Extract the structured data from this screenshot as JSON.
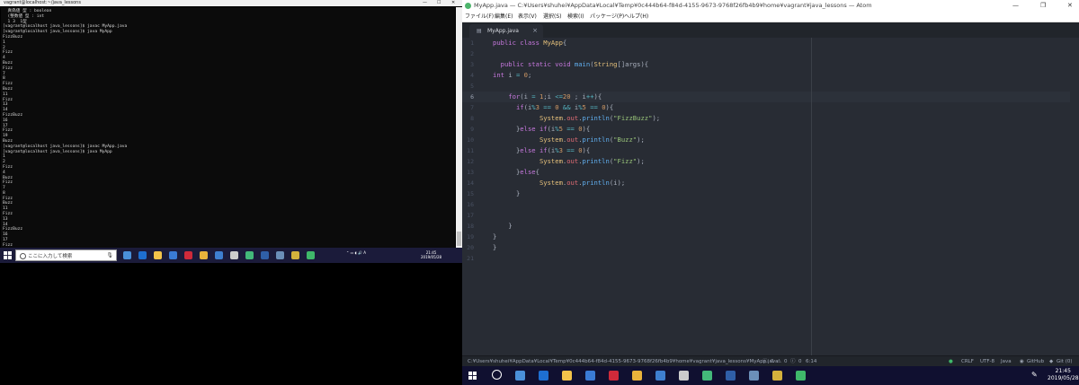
{
  "terminal": {
    "title": "vagrant@localhost:~/java_lessons",
    "controls": [
      "—",
      "☐",
      "✕"
    ],
    "lines": [
      "  真偽値 型 : boolean",
      "  (整数値 型 : int",
      "  1 3  1型",
      "[vagrant@localhost java_lessons]$ javac MyApp.java",
      "[vagrant@localhost java_lessons]$ java MyApp",
      "FizzBuzz",
      "1",
      "2",
      "Fizz",
      "4",
      "Buzz",
      "Fizz",
      "7",
      "8",
      "Fizz",
      "Buzz",
      "11",
      "Fizz",
      "13",
      "14",
      "FizzBuzz",
      "16",
      "17",
      "Fizz",
      "19",
      "Buzz",
      "[vagrant@localhost java_lessons]$ javac MyApp.java",
      "[vagrant@localhost java_lessons]$ java MyApp",
      "1",
      "2",
      "Fizz",
      "4",
      "Buzz",
      "Fizz",
      "7",
      "8",
      "Fizz",
      "Buzz",
      "11",
      "Fizz",
      "13",
      "14",
      "FizzBuzz",
      "16",
      "17",
      "Fizz",
      "19",
      "Buzz"
    ],
    "prompt": "[vagrant@localhost java_lessons]$ "
  },
  "taskbar_left": {
    "search_placeholder": "ここに入力して検索",
    "clock_time": "21:45",
    "clock_date": "2019/05/28",
    "icons": [
      {
        "name": "task-view-icon",
        "color": "#4a90d9"
      },
      {
        "name": "edge-icon",
        "color": "#1e6fd0"
      },
      {
        "name": "explorer-icon",
        "color": "#f3c34a"
      },
      {
        "name": "store-icon",
        "color": "#3a7bd5"
      },
      {
        "name": "opera-icon",
        "color": "#d02a3a"
      },
      {
        "name": "chrome-icon",
        "color": "#e9b33b"
      },
      {
        "name": "mail-icon",
        "color": "#3e7fcf"
      },
      {
        "name": "media-icon",
        "color": "#cccccc"
      },
      {
        "name": "atom-app-icon",
        "color": "#43b97a"
      },
      {
        "name": "powershell-icon",
        "color": "#2f5fa7"
      },
      {
        "name": "terminal-app-icon",
        "color": "#6b8fb8"
      },
      {
        "name": "app-yellow-icon",
        "color": "#d4b13c"
      },
      {
        "name": "app-green-icon",
        "color": "#3fb86a"
      }
    ]
  },
  "atom": {
    "title": "MyApp.java — C:¥Users¥shuhei¥AppData¥Local¥Temp¥0c444b64-f84d-4155-9673-9768f26fb4b9¥home¥vagrant¥java_lessons — Atom",
    "window_controls": [
      "—",
      "❐",
      "✕"
    ],
    "menu": [
      "ファイル(F)",
      "編集(E)",
      "表示(V)",
      "選択(S)",
      "検索(I)",
      "パッケージ(P)",
      "ヘルプ(H)"
    ],
    "tab_label": "MyApp.java",
    "active_line": 6,
    "lines": [
      [
        [
          "kw",
          "public "
        ],
        [
          "kw",
          "class "
        ],
        [
          "cls",
          "MyApp"
        ],
        [
          "p",
          "{"
        ]
      ],
      [],
      [
        [
          "p",
          "  "
        ],
        [
          "kw",
          "public "
        ],
        [
          "kw",
          "static "
        ],
        [
          "kw",
          "void "
        ],
        [
          "fn",
          "main"
        ],
        [
          "p",
          "("
        ],
        [
          "cls",
          "String"
        ],
        [
          "p",
          "[]args){"
        ]
      ],
      [
        [
          "kw",
          "int "
        ],
        [
          "p",
          "i "
        ],
        [
          "op",
          "= "
        ],
        [
          "num",
          "0"
        ],
        [
          "p",
          ";"
        ]
      ],
      [],
      [
        [
          "p",
          "    "
        ],
        [
          "kw",
          "for"
        ],
        [
          "p",
          "(i "
        ],
        [
          "op",
          "= "
        ],
        [
          "num",
          "1"
        ],
        [
          "p",
          ";i "
        ],
        [
          "op",
          "<="
        ],
        [
          "num",
          "20"
        ],
        [
          "p",
          " ; i"
        ],
        [
          "op",
          "++"
        ],
        [
          "p",
          "){"
        ]
      ],
      [
        [
          "p",
          "      "
        ],
        [
          "kw",
          "if"
        ],
        [
          "p",
          "(i"
        ],
        [
          "op",
          "%"
        ],
        [
          "num",
          "3"
        ],
        [
          "p",
          " "
        ],
        [
          "op",
          "=="
        ],
        [
          "p",
          " "
        ],
        [
          "num",
          "0"
        ],
        [
          "p",
          " "
        ],
        [
          "op",
          "&&"
        ],
        [
          "p",
          " i"
        ],
        [
          "op",
          "%"
        ],
        [
          "num",
          "5"
        ],
        [
          "p",
          " "
        ],
        [
          "op",
          "=="
        ],
        [
          "p",
          " "
        ],
        [
          "num",
          "0"
        ],
        [
          "p",
          "){"
        ]
      ],
      [
        [
          "p",
          "            "
        ],
        [
          "cls",
          "System"
        ],
        [
          "p",
          "."
        ],
        [
          "obj",
          "out"
        ],
        [
          "p",
          "."
        ],
        [
          "fn",
          "println"
        ],
        [
          "p",
          "("
        ],
        [
          "str",
          "\"FizzBuzz\""
        ],
        [
          "p",
          ");"
        ]
      ],
      [
        [
          "p",
          "      }"
        ],
        [
          "kw",
          "else "
        ],
        [
          "kw",
          "if"
        ],
        [
          "p",
          "(i"
        ],
        [
          "op",
          "%"
        ],
        [
          "num",
          "5"
        ],
        [
          "p",
          " "
        ],
        [
          "op",
          "=="
        ],
        [
          "p",
          " "
        ],
        [
          "num",
          "0"
        ],
        [
          "p",
          "){"
        ]
      ],
      [
        [
          "p",
          "            "
        ],
        [
          "cls",
          "System"
        ],
        [
          "p",
          "."
        ],
        [
          "obj",
          "out"
        ],
        [
          "p",
          "."
        ],
        [
          "fn",
          "println"
        ],
        [
          "p",
          "("
        ],
        [
          "str",
          "\"Buzz\""
        ],
        [
          "p",
          ");"
        ]
      ],
      [
        [
          "p",
          "      }"
        ],
        [
          "kw",
          "else "
        ],
        [
          "kw",
          "if"
        ],
        [
          "p",
          "(i"
        ],
        [
          "op",
          "%"
        ],
        [
          "num",
          "3"
        ],
        [
          "p",
          " "
        ],
        [
          "op",
          "=="
        ],
        [
          "p",
          " "
        ],
        [
          "num",
          "0"
        ],
        [
          "p",
          "){"
        ]
      ],
      [
        [
          "p",
          "            "
        ],
        [
          "cls",
          "System"
        ],
        [
          "p",
          "."
        ],
        [
          "obj",
          "out"
        ],
        [
          "p",
          "."
        ],
        [
          "fn",
          "println"
        ],
        [
          "p",
          "("
        ],
        [
          "str",
          "\"Fizz\""
        ],
        [
          "p",
          ");"
        ]
      ],
      [
        [
          "p",
          "      }"
        ],
        [
          "kw",
          "else"
        ],
        [
          "p",
          "{"
        ]
      ],
      [
        [
          "p",
          "            "
        ],
        [
          "cls",
          "System"
        ],
        [
          "p",
          "."
        ],
        [
          "obj",
          "out"
        ],
        [
          "p",
          "."
        ],
        [
          "fn",
          "println"
        ],
        [
          "p",
          "(i);"
        ]
      ],
      [
        [
          "p",
          "      }"
        ]
      ],
      [],
      [],
      [
        [
          "p",
          "    }"
        ]
      ],
      [
        [
          "p",
          "}"
        ]
      ],
      [
        [
          "p",
          "}"
        ]
      ],
      []
    ],
    "status": {
      "path": "C:¥Users¥shuhei¥AppData¥Local¥Temp¥0c444b64-f84d-4155-9673-9768f26fb4b9¥home¥vagrant¥java_lessons¥MyApp.java",
      "errors": "0",
      "warnings": "0",
      "infos": "0",
      "cursor": "6:14",
      "line_ending": "CRLF",
      "encoding": "UTF-8",
      "grammar": "Java",
      "github": "GitHub",
      "git": "Git (0)"
    }
  },
  "taskbar_right": {
    "clock_time": "21:45",
    "clock_date": "2019/05/28"
  }
}
